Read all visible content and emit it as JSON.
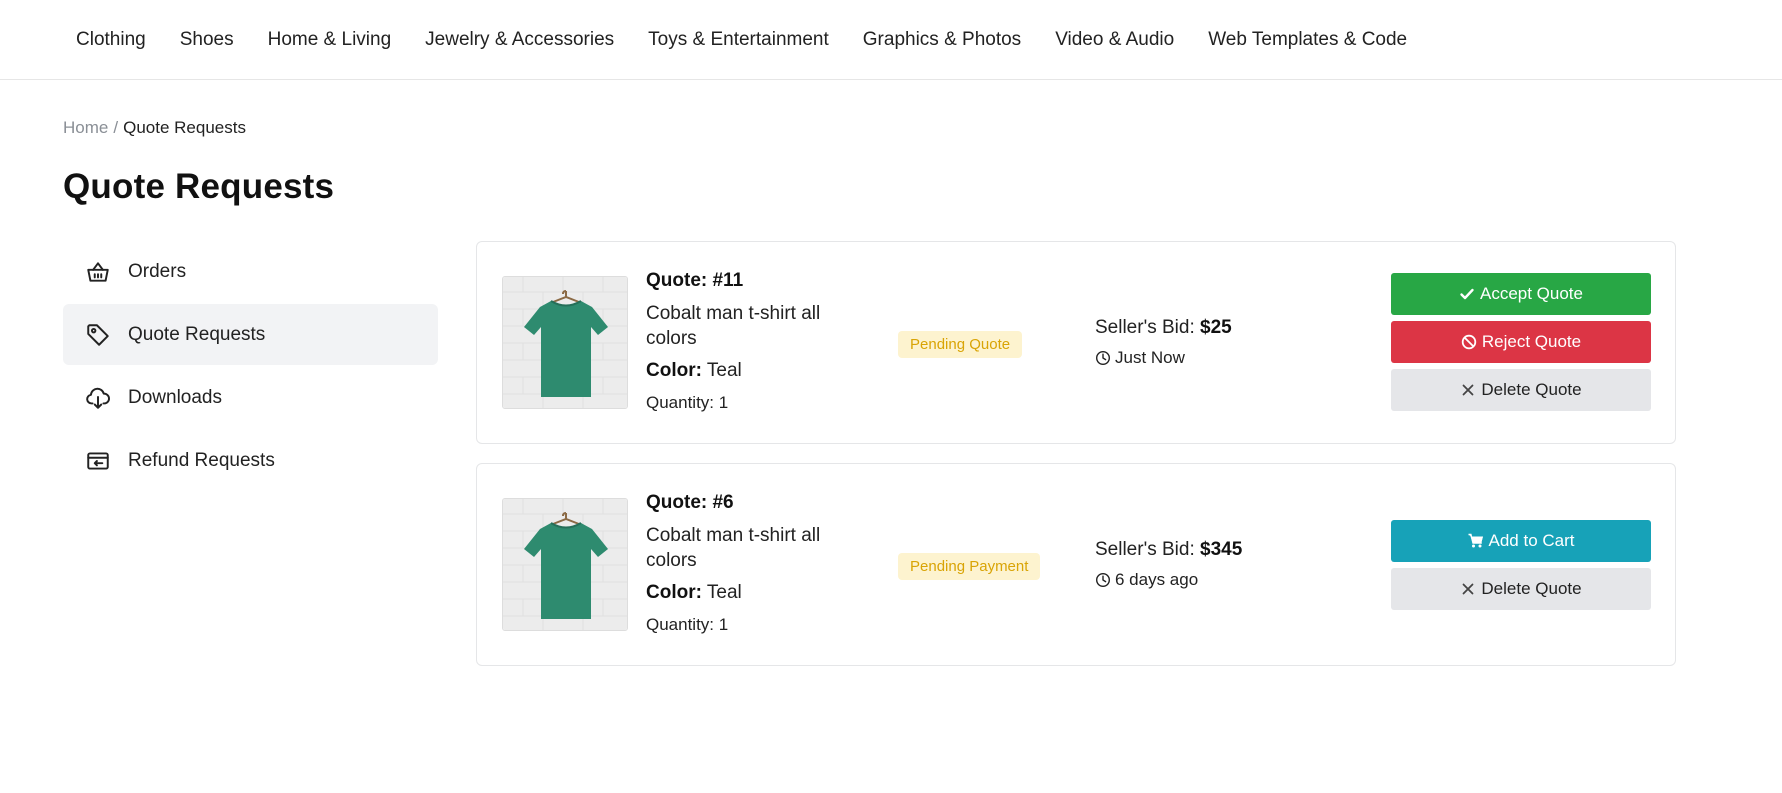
{
  "nav": {
    "items": [
      {
        "label": "Clothing"
      },
      {
        "label": "Shoes"
      },
      {
        "label": "Home & Living"
      },
      {
        "label": "Jewelry & Accessories"
      },
      {
        "label": "Toys & Entertainment"
      },
      {
        "label": "Graphics & Photos"
      },
      {
        "label": "Video & Audio"
      },
      {
        "label": "Web Templates & Code"
      }
    ]
  },
  "breadcrumb": {
    "home": "Home",
    "separator": "/",
    "current": "Quote Requests"
  },
  "page_title": "Quote Requests",
  "sidebar": {
    "items": [
      {
        "label": "Orders",
        "icon": "basket-icon"
      },
      {
        "label": "Quote Requests",
        "icon": "tag-icon",
        "active": true
      },
      {
        "label": "Downloads",
        "icon": "cloud-download-icon"
      },
      {
        "label": "Refund Requests",
        "icon": "refund-icon"
      }
    ]
  },
  "quotes": [
    {
      "number": "Quote: #11",
      "product": "Cobalt man t-shirt all colors",
      "color_label": "Color:",
      "color_value": "Teal",
      "quantity": "Quantity: 1",
      "status": "Pending Quote",
      "bid_label": "Seller's Bid:",
      "bid_value": "$25",
      "time": "Just Now",
      "actions": {
        "accept": "Accept Quote",
        "reject": "Reject Quote",
        "delete": "Delete Quote"
      }
    },
    {
      "number": "Quote: #6",
      "product": "Cobalt man t-shirt all colors",
      "color_label": "Color:",
      "color_value": "Teal",
      "quantity": "Quantity: 1",
      "status": "Pending Payment",
      "bid_label": "Seller's Bid:",
      "bid_value": "$345",
      "time": "6 days ago",
      "actions": {
        "cart": "Add to Cart",
        "delete": "Delete Quote"
      }
    }
  ],
  "colors": {
    "accept": "#28a745",
    "reject": "#dc3545",
    "cart": "#17a2b8",
    "delete": "#e5e6e9",
    "badge_bg": "#fdf3cf",
    "badge_text": "#d9a406",
    "tshirt": "#2e8b6f"
  }
}
